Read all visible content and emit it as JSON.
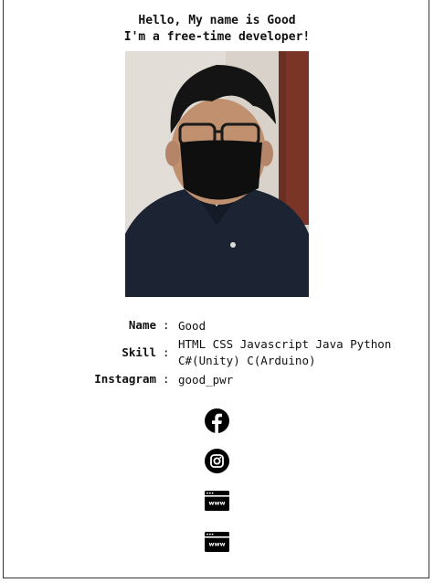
{
  "greeting": {
    "line1": "Hello, My name is Good",
    "line2": "I'm a free-time developer!"
  },
  "profile": {
    "name_label": "Name",
    "name_value": "Good",
    "skill_label": "Skill",
    "skill_line1": "HTML CSS Javascript Java Python",
    "skill_line2": "C#(Unity) C(Arduino)",
    "instagram_label": "Instagram",
    "instagram_value": "good_pwr",
    "separator": ":"
  },
  "links": [
    {
      "icon": "facebook-icon"
    },
    {
      "icon": "instagram-icon"
    },
    {
      "icon": "website-icon"
    },
    {
      "icon": "website-icon"
    }
  ],
  "colors": {
    "text": "#111111",
    "icon": "#000000",
    "border": "#333333"
  }
}
